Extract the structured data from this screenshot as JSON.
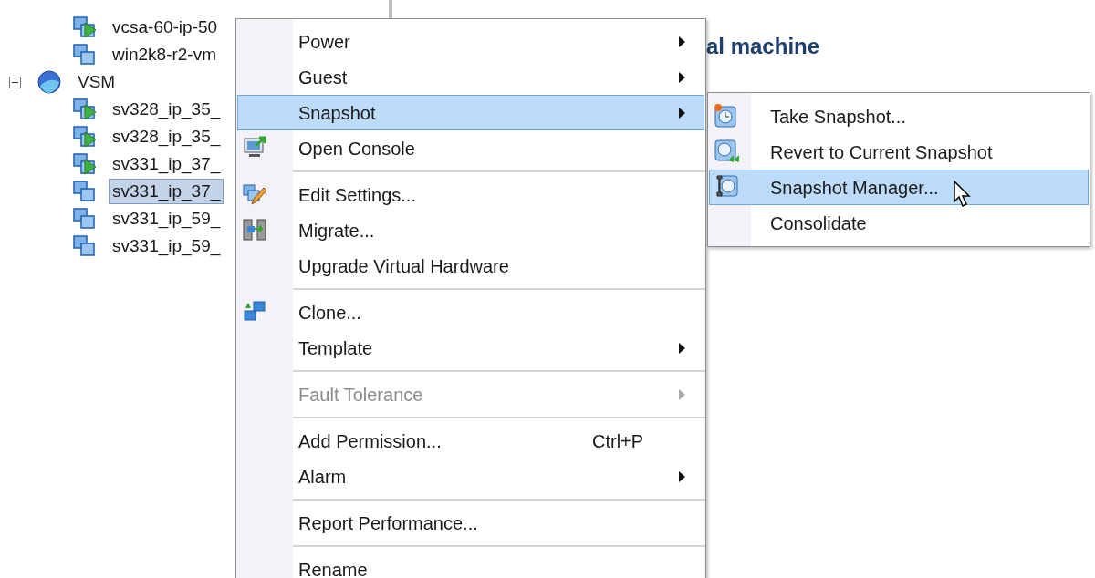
{
  "tree": [
    {
      "kind": "vm",
      "label": "vcsa-60-ip-50",
      "powered_on": true,
      "selected": false
    },
    {
      "kind": "vm",
      "label": "win2k8-r2-vm",
      "powered_on": false,
      "selected": false
    },
    {
      "kind": "pool",
      "label": "VSM",
      "expanded": true,
      "selected": false,
      "children": [
        {
          "kind": "vm",
          "label": "sv328_ip_35_",
          "powered_on": true,
          "selected": false
        },
        {
          "kind": "vm",
          "label": "sv328_ip_35_",
          "powered_on": true,
          "selected": false
        },
        {
          "kind": "vm",
          "label": "sv331_ip_37_",
          "powered_on": true,
          "selected": false
        },
        {
          "kind": "vm",
          "label": "sv331_ip_37_",
          "powered_on": false,
          "selected": true
        },
        {
          "kind": "vm",
          "label": "sv331_ip_59_",
          "powered_on": false,
          "selected": false
        },
        {
          "kind": "vm",
          "label": "sv331_ip_59_",
          "powered_on": false,
          "selected": false
        }
      ]
    }
  ],
  "heading": "al machine",
  "context_menu": [
    {
      "kind": "item",
      "label": "Power",
      "submenu": true,
      "selected": false,
      "disabled": false
    },
    {
      "kind": "item",
      "label": "Guest",
      "submenu": true,
      "selected": false,
      "disabled": false
    },
    {
      "kind": "item",
      "label": "Snapshot",
      "submenu": true,
      "selected": true,
      "disabled": false
    },
    {
      "kind": "item",
      "label": "Open Console",
      "submenu": false,
      "selected": false,
      "disabled": false
    },
    {
      "kind": "separator"
    },
    {
      "kind": "item",
      "label": "Edit Settings...",
      "submenu": false,
      "selected": false,
      "disabled": false
    },
    {
      "kind": "item",
      "label": "Migrate...",
      "submenu": false,
      "selected": false,
      "disabled": false
    },
    {
      "kind": "item",
      "label": "Upgrade Virtual Hardware",
      "submenu": false,
      "selected": false,
      "disabled": false
    },
    {
      "kind": "separator"
    },
    {
      "kind": "item",
      "label": "Clone...",
      "submenu": false,
      "selected": false,
      "disabled": false
    },
    {
      "kind": "item",
      "label": "Template",
      "submenu": true,
      "selected": false,
      "disabled": false
    },
    {
      "kind": "separator"
    },
    {
      "kind": "item",
      "label": "Fault Tolerance",
      "submenu": true,
      "selected": false,
      "disabled": true
    },
    {
      "kind": "separator"
    },
    {
      "kind": "item",
      "label": "Add Permission...",
      "shortcut": "Ctrl+P",
      "submenu": false,
      "selected": false,
      "disabled": false
    },
    {
      "kind": "item",
      "label": "Alarm",
      "submenu": true,
      "selected": false,
      "disabled": false
    },
    {
      "kind": "separator"
    },
    {
      "kind": "item",
      "label": "Report Performance...",
      "submenu": false,
      "selected": false,
      "disabled": false
    },
    {
      "kind": "separator"
    },
    {
      "kind": "item",
      "label": "Rename",
      "submenu": false,
      "selected": false,
      "disabled": false
    }
  ],
  "snapshot_submenu": [
    {
      "label": "Take Snapshot...",
      "selected": false
    },
    {
      "label": "Revert to Current Snapshot",
      "selected": false
    },
    {
      "label": "Snapshot Manager...",
      "selected": true
    },
    {
      "label": "Consolidate",
      "selected": false
    }
  ]
}
